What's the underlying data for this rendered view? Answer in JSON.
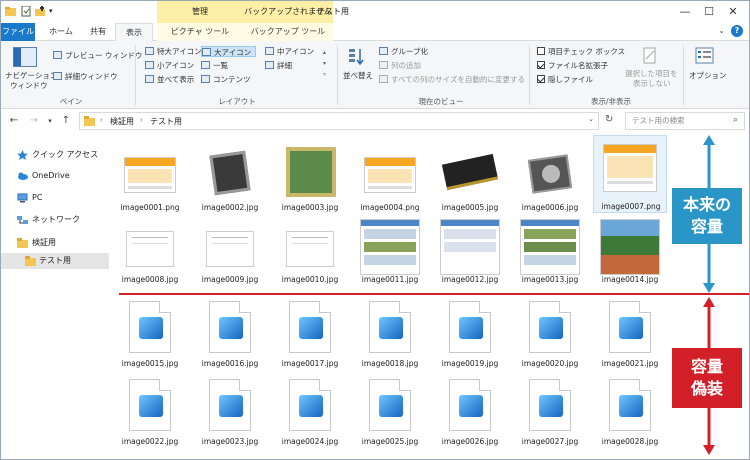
{
  "window": {
    "title": "テスト用",
    "context_groups": [
      {
        "label": "管理",
        "color": "#fdf0a6"
      },
      {
        "label": "バックアップされません",
        "color": "#fdf0a6"
      }
    ],
    "controls": {
      "minimize": "—",
      "maximize": "☐",
      "close": "✕"
    }
  },
  "tabs": [
    {
      "label": "ファイル"
    },
    {
      "label": "ホーム"
    },
    {
      "label": "共有"
    },
    {
      "label": "表示"
    },
    {
      "label": "ピクチャ ツール"
    },
    {
      "label": "バックアップ ツール"
    }
  ],
  "ribbon": {
    "pane": {
      "nav_pane_line1": "ナビゲーション",
      "nav_pane_line2": "ウィンドウ",
      "preview": "プレビュー ウィンドウ",
      "details": "詳細ウィンドウ",
      "label": "ペイン"
    },
    "layout": {
      "items": [
        "特大アイコン",
        "大アイコン",
        "中アイコン",
        "小アイコン",
        "一覧",
        "詳細",
        "並べて表示",
        "コンテンツ"
      ],
      "label": "レイアウト"
    },
    "current_view": {
      "sort": "並べ替え",
      "group_by": "グループ化",
      "add_columns": "列の追加",
      "fit_columns": "すべての列のサイズを自動的に変更する",
      "label": "現在のビュー"
    },
    "show_hide": {
      "item_checkbox": "項目チェック ボックス",
      "file_ext": "ファイル名拡張子",
      "hidden_items": "隠しファイル",
      "hide_selected_line1": "選択した項目を",
      "hide_selected_line2": "表示しない",
      "label": "表示/非表示"
    },
    "options": "オプション"
  },
  "address": {
    "crumbs": [
      "検証用",
      "テスト用"
    ],
    "search_placeholder": "テスト用の検索"
  },
  "nav_pane": [
    {
      "label": "クイック アクセス",
      "icon": "star-icon"
    },
    {
      "label": "OneDrive",
      "icon": "cloud-icon"
    },
    {
      "label": "PC",
      "icon": "pc-icon"
    },
    {
      "label": "ネットワーク",
      "icon": "network-icon"
    },
    {
      "label": "検証用",
      "icon": "folder-icon"
    },
    {
      "label": "テスト用",
      "icon": "folder-icon"
    }
  ],
  "files": [
    {
      "name": "image0001.png"
    },
    {
      "name": "image0002.jpg"
    },
    {
      "name": "image0003.jpg"
    },
    {
      "name": "image0004.png"
    },
    {
      "name": "image0005.jpg"
    },
    {
      "name": "image0006.jpg"
    },
    {
      "name": "image0007.png"
    },
    {
      "name": "image0008.jpg"
    },
    {
      "name": "image0009.jpg"
    },
    {
      "name": "image0010.jpg"
    },
    {
      "name": "image0011.jpg"
    },
    {
      "name": "image0012.jpg"
    },
    {
      "name": "image0013.jpg"
    },
    {
      "name": "image0014.jpg"
    },
    {
      "name": "image0015.jpg"
    },
    {
      "name": "image0016.jpg"
    },
    {
      "name": "image0017.jpg"
    },
    {
      "name": "image0018.jpg"
    },
    {
      "name": "image0019.jpg"
    },
    {
      "name": "image0020.jpg"
    },
    {
      "name": "image0021.jpg"
    },
    {
      "name": "image0022.jpg"
    },
    {
      "name": "image0023.jpg"
    },
    {
      "name": "image0024.jpg"
    },
    {
      "name": "image0025.jpg"
    },
    {
      "name": "image0026.jpg"
    },
    {
      "name": "image0027.jpg"
    },
    {
      "name": "image0028.jpg"
    }
  ],
  "annotations": {
    "real_line1": "本来の",
    "real_line2": "容量",
    "fake_line1": "容量",
    "fake_line2": "偽装",
    "blue": "#2a96c8",
    "red": "#d32028"
  }
}
